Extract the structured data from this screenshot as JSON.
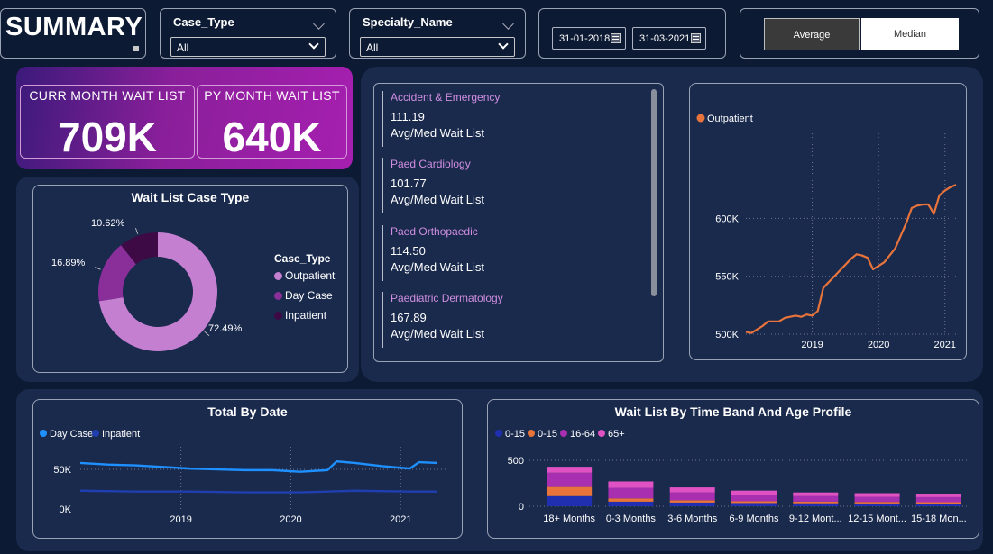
{
  "header": {
    "summary_title": "SUMMARY",
    "case_type_slicer": {
      "title": "Case_Type",
      "value": "All"
    },
    "specialty_slicer": {
      "title": "Specialty_Name",
      "value": "All"
    },
    "date_from": "31-01-2018",
    "date_to": "31-03-2021",
    "toggle": {
      "average_label": "Average",
      "median_label": "Median",
      "selected": "Average"
    }
  },
  "kpis": {
    "curr_label": "CURR MONTH WAIT LIST",
    "curr_value": "709K",
    "py_label": "PY MONTH WAIT LIST",
    "py_value": "640K"
  },
  "donut": {
    "title": "Wait List Case Type",
    "legend_title": "Case_Type",
    "colors": {
      "Outpatient": "#c47fd1",
      "Day Case": "#8a2f9a",
      "Inpatient": "#3d0a45"
    }
  },
  "specialties": [
    {
      "name": "Accident & Emergency",
      "value": "111.19",
      "label": "Avg/Med Wait List"
    },
    {
      "name": "Paed Cardiology",
      "value": "101.77",
      "label": "Avg/Med Wait List"
    },
    {
      "name": "Paed Orthopaedic",
      "value": "114.50",
      "label": "Avg/Med Wait List"
    },
    {
      "name": "Paediatric Dermatology",
      "value": "167.89",
      "label": "Avg/Med Wait List"
    }
  ],
  "chart_data": [
    {
      "type": "pie",
      "title": "Wait List Case Type",
      "categories": [
        "Outpatient",
        "Day Case",
        "Inpatient"
      ],
      "values": [
        72.49,
        16.89,
        10.62
      ],
      "labels": [
        "72.49%",
        "16.89%",
        "10.62%"
      ]
    },
    {
      "type": "line",
      "title": "",
      "series": [
        {
          "name": "Outpatient",
          "color": "#e8743b",
          "x": [
            "2018-01",
            "2018-02",
            "2018-03",
            "2018-04",
            "2018-05",
            "2018-06",
            "2018-07",
            "2018-08",
            "2018-09",
            "2018-10",
            "2018-11",
            "2018-12",
            "2019-01",
            "2019-02",
            "2019-03",
            "2019-04",
            "2019-05",
            "2019-06",
            "2019-07",
            "2019-08",
            "2019-09",
            "2019-10",
            "2019-11",
            "2019-12",
            "2020-01",
            "2020-02",
            "2020-03",
            "2020-04",
            "2020-05",
            "2020-06",
            "2020-07",
            "2020-08",
            "2020-09",
            "2020-10",
            "2020-11",
            "2020-12",
            "2021-01",
            "2021-02",
            "2021-03"
          ],
          "values": [
            502,
            501,
            504,
            507,
            511,
            511,
            511,
            514,
            515,
            516,
            515,
            517,
            516,
            520,
            540,
            545,
            550,
            555,
            560,
            565,
            569,
            568,
            566,
            556,
            559,
            562,
            568,
            574,
            585,
            596,
            609,
            611,
            612,
            612,
            604,
            620,
            624,
            627,
            629
          ]
        }
      ],
      "ylim": [
        500,
        640
      ],
      "yticks": [
        "500K",
        "550K",
        "600K"
      ],
      "xticks": [
        "2019",
        "2020",
        "2021"
      ],
      "legend": "top-left"
    },
    {
      "type": "line",
      "title": "Total By Date",
      "series": [
        {
          "name": "Day Case",
          "color": "#1e90ff",
          "x": [
            "2018-02",
            "2018-05",
            "2018-08",
            "2018-11",
            "2019-02",
            "2019-05",
            "2019-08",
            "2019-11",
            "2020-02",
            "2020-05",
            "2020-06",
            "2020-08",
            "2020-11",
            "2021-02",
            "2021-03",
            "2021-05"
          ],
          "values": [
            58,
            56,
            55,
            53,
            51,
            50,
            49,
            49,
            47,
            49,
            60,
            58,
            54,
            51,
            59,
            58
          ]
        },
        {
          "name": "Inpatient",
          "color": "#1f3fb0",
          "x": [
            "2018-02",
            "2018-08",
            "2019-02",
            "2019-08",
            "2020-02",
            "2020-05",
            "2020-08",
            "2021-02",
            "2021-05"
          ],
          "values": [
            23,
            22,
            22,
            21,
            21,
            22,
            23,
            22,
            22
          ]
        }
      ],
      "ylim": [
        0,
        75
      ],
      "yticks": [
        "0K",
        "50K"
      ],
      "xticks": [
        "2019",
        "2020",
        "2021"
      ],
      "legend": "top-left"
    },
    {
      "type": "bar",
      "title": "Wait List By Time Band And Age Profile",
      "categories": [
        "18+ Months",
        "0-3 Months",
        "3-6 Months",
        "6-9 Months",
        "9-12 Mont...",
        "12-15 Mont...",
        "15-18 Mon..."
      ],
      "series": [
        {
          "name": "0-15",
          "color": "#1f2fb0",
          "values": [
            110,
            50,
            40,
            35,
            32,
            30,
            28
          ]
        },
        {
          "name": "0-15",
          "color": "#e8743b",
          "values": [
            100,
            35,
            25,
            20,
            18,
            17,
            16
          ]
        },
        {
          "name": "16-64",
          "color": "#a82fb0",
          "values": [
            155,
            115,
            85,
            65,
            60,
            55,
            55
          ]
        },
        {
          "name": "65+",
          "color": "#e052c4",
          "values": [
            65,
            70,
            55,
            50,
            40,
            40,
            38
          ]
        }
      ],
      "yticks": [
        "0",
        "500"
      ],
      "ylim": [
        0,
        500
      ],
      "legend": "top-left"
    }
  ]
}
